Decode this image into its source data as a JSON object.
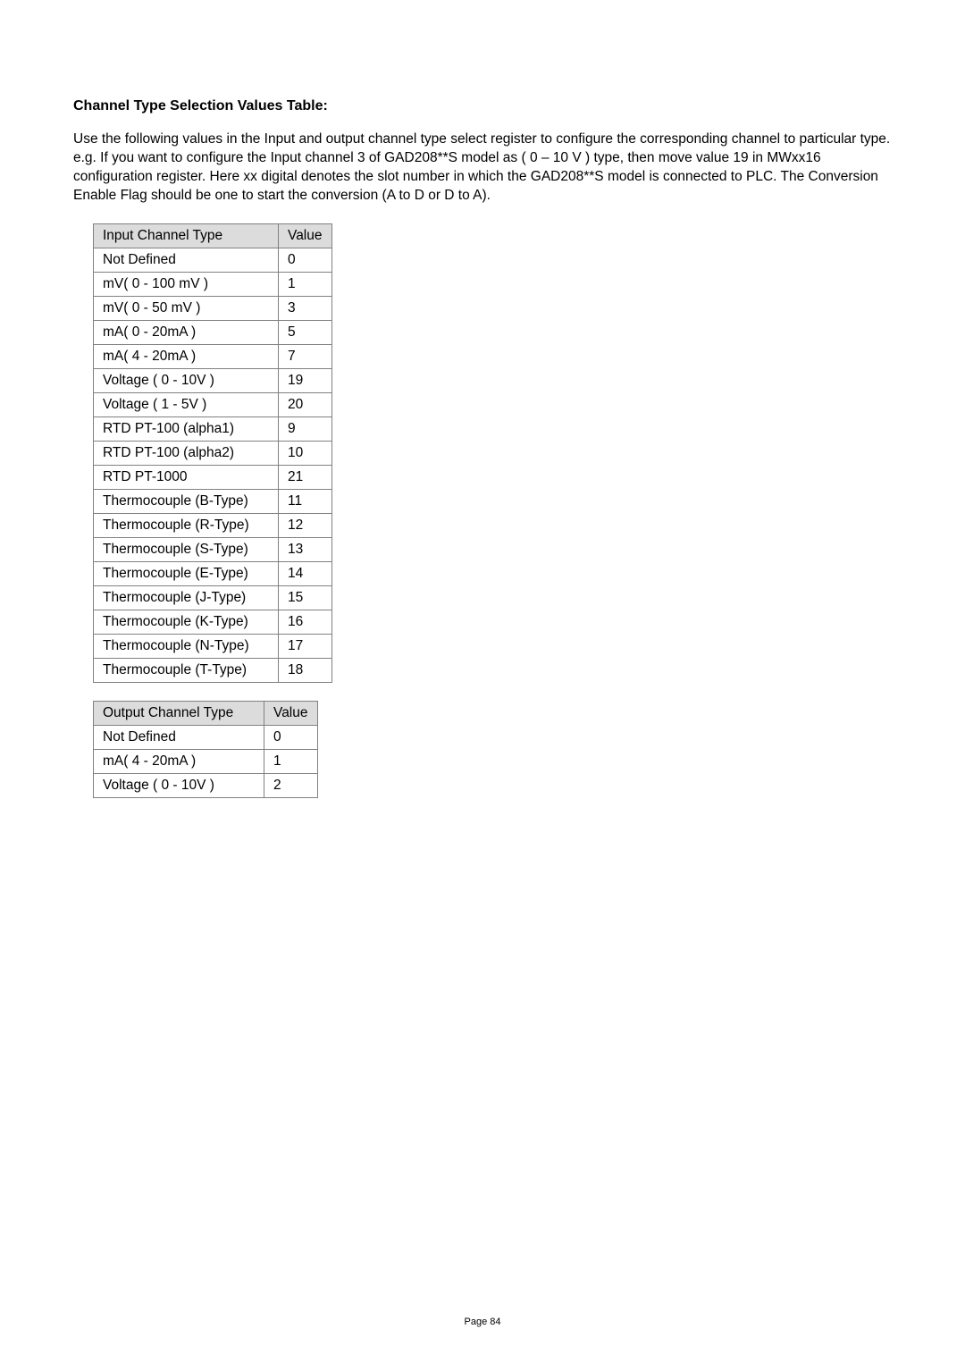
{
  "section_title": "Channel Type Selection Values Table:",
  "intro_paragraph1": "Use the following values in the Input and output channel type select register to configure the corresponding channel to particular type.",
  "intro_paragraph2": "e.g. If you want to configure the Input channel 3 of GAD208**S model as ( 0 – 10 V ) type, then move value 19 in MWxx16 configuration register. Here xx digital denotes the slot number in which the GAD208**S model is connected to PLC. The Conversion Enable Flag should be one to start the conversion (A to D or D to A).",
  "input_table": {
    "header": {
      "type": "Input Channel Type",
      "value": "Value"
    },
    "rows": [
      {
        "type": "Not Defined",
        "value": "0"
      },
      {
        "type": "mV( 0 - 100 mV )",
        "value": "1"
      },
      {
        "type": "mV( 0 - 50 mV )",
        "value": "3"
      },
      {
        "type": "mA( 0 - 20mA )",
        "value": "5"
      },
      {
        "type": "mA( 4 - 20mA )",
        "value": "7"
      },
      {
        "type": "Voltage ( 0 - 10V )",
        "value": "19"
      },
      {
        "type": "Voltage ( 1 - 5V )",
        "value": "20"
      },
      {
        "type": "RTD PT-100 (alpha1)",
        "value": "9"
      },
      {
        "type": "RTD PT-100 (alpha2)",
        "value": "10"
      },
      {
        "type": "RTD PT-1000",
        "value": "21"
      },
      {
        "type": "Thermocouple (B-Type)",
        "value": "11"
      },
      {
        "type": "Thermocouple (R-Type)",
        "value": "12"
      },
      {
        "type": "Thermocouple (S-Type)",
        "value": "13"
      },
      {
        "type": "Thermocouple (E-Type)",
        "value": "14"
      },
      {
        "type": "Thermocouple (J-Type)",
        "value": "15"
      },
      {
        "type": "Thermocouple (K-Type)",
        "value": "16"
      },
      {
        "type": "Thermocouple (N-Type)",
        "value": "17"
      },
      {
        "type": "Thermocouple (T-Type)",
        "value": "18"
      }
    ]
  },
  "output_table": {
    "header": {
      "type": "Output Channel Type",
      "value": "Value"
    },
    "rows": [
      {
        "type": "Not Defined",
        "value": "0"
      },
      {
        "type": "mA( 4 - 20mA )",
        "value": "1"
      },
      {
        "type": "Voltage ( 0 - 10V )",
        "value": "2"
      }
    ]
  },
  "page_number": "Page 84"
}
